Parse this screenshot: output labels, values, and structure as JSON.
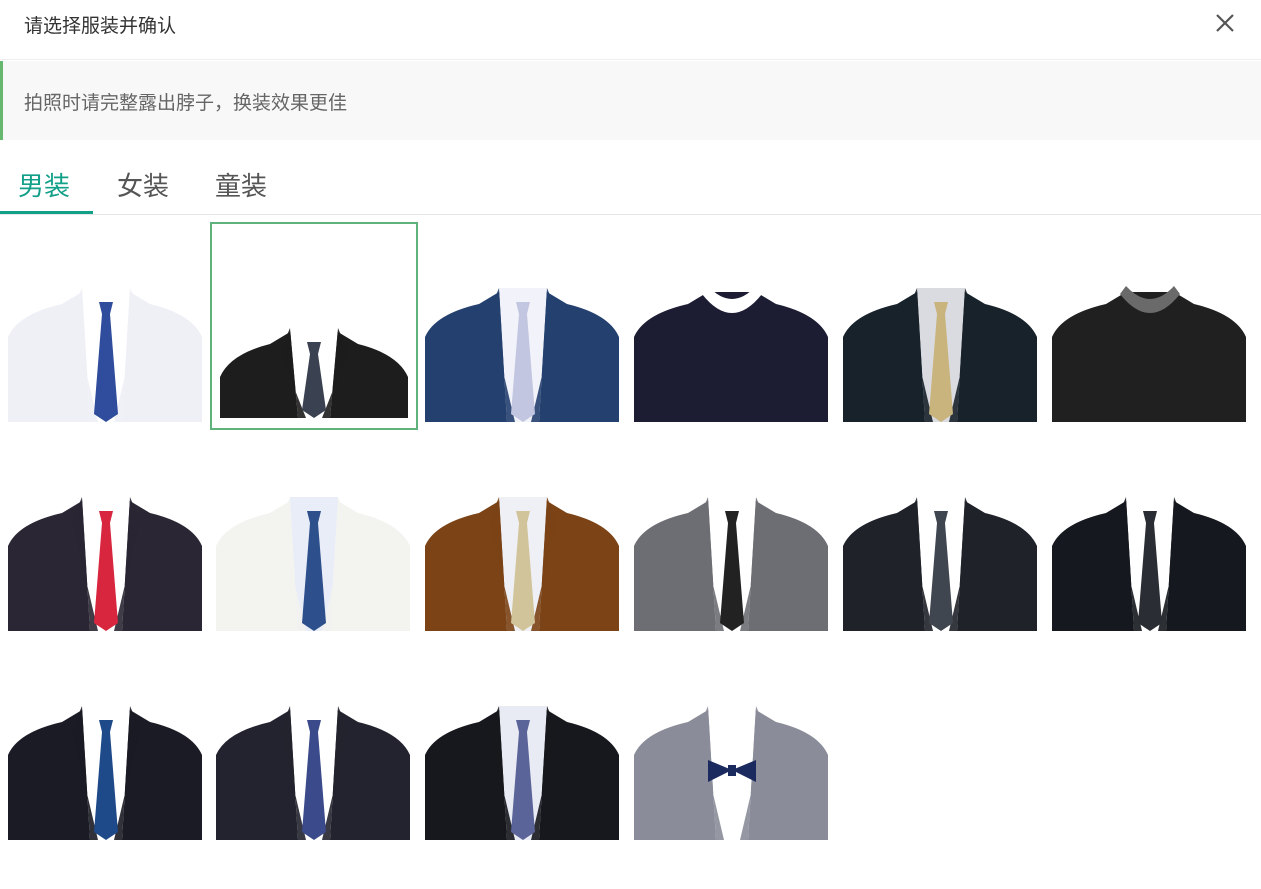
{
  "dialog": {
    "title": "请选择服装并确认",
    "close_icon": "close-icon"
  },
  "notice": {
    "text": "拍照时请完整露出脖子，换装效果更佳"
  },
  "tabs": [
    {
      "label": "男装",
      "active": true
    },
    {
      "label": "女装",
      "active": false
    },
    {
      "label": "童装",
      "active": false
    }
  ],
  "colors": {
    "accent": "#13a089",
    "selected_border": "#5fb27a",
    "tip_bar": "#67b86f"
  },
  "outfits": [
    {
      "name": "white-shirt-blue-tie",
      "jacket": "#eef0f6",
      "shirt": "#ffffff",
      "tie": "#2f4d9c",
      "selected": false
    },
    {
      "name": "black-suit-gray-tie",
      "jacket": "#1d1d1d",
      "shirt": "#ffffff",
      "tie": "#3a4150",
      "selected": true
    },
    {
      "name": "navy-suit-lavender-tie",
      "jacket": "#24406f",
      "shirt": "#f2f3fa",
      "tie": "#c3c6e0",
      "selected": false
    },
    {
      "name": "navy-sweater",
      "jacket": "#1c1d33",
      "shirt": "#ffffff",
      "tie": "",
      "selected": false
    },
    {
      "name": "black-suit-gold-tie",
      "jacket": "#18222b",
      "shirt": "#d9dbe0",
      "tie": "#c9b47d",
      "selected": false
    },
    {
      "name": "black-sweater-gray-collar",
      "jacket": "#202020",
      "shirt": "#6a6a6a",
      "tie": "",
      "selected": false
    },
    {
      "name": "dark-suit-red-tie-badge",
      "jacket": "#2a2633",
      "shirt": "#ffffff",
      "tie": "#d8263f",
      "selected": false
    },
    {
      "name": "white-suit-blue-tie",
      "jacket": "#f3f3f0",
      "shirt": "#e8edf8",
      "tie": "#2d4f8c",
      "selected": false
    },
    {
      "name": "brown-suit-gold-tie",
      "jacket": "#7b4316",
      "shirt": "#eef0f6",
      "tie": "#d2c49a",
      "selected": false
    },
    {
      "name": "gray-suit-black-tie",
      "jacket": "#6d6e73",
      "shirt": "#ffffff",
      "tie": "#222222",
      "selected": false
    },
    {
      "name": "black-suit-charcoal-tie",
      "jacket": "#1f2229",
      "shirt": "#ffffff",
      "tie": "#3f4650",
      "selected": false
    },
    {
      "name": "black-suit-black-tie",
      "jacket": "#15181e",
      "shirt": "#ffffff",
      "tie": "#2a2d33",
      "selected": false
    },
    {
      "name": "black-suit-navy-tie",
      "jacket": "#1a1b24",
      "shirt": "#ffffff",
      "tie": "#1f4a8a",
      "selected": false
    },
    {
      "name": "charcoal-suit-striped-tie",
      "jacket": "#22232e",
      "shirt": "#ffffff",
      "tie": "#3b4a8a",
      "selected": false
    },
    {
      "name": "black-suit-blue-striped-tie",
      "jacket": "#17181d",
      "shirt": "#e9ebf4",
      "tie": "#5a6498",
      "selected": false
    },
    {
      "name": "gray-suit-bow-tie",
      "jacket": "#8a8d99",
      "shirt": "#ffffff",
      "tie": "#1b2a5e",
      "selected": false
    }
  ]
}
